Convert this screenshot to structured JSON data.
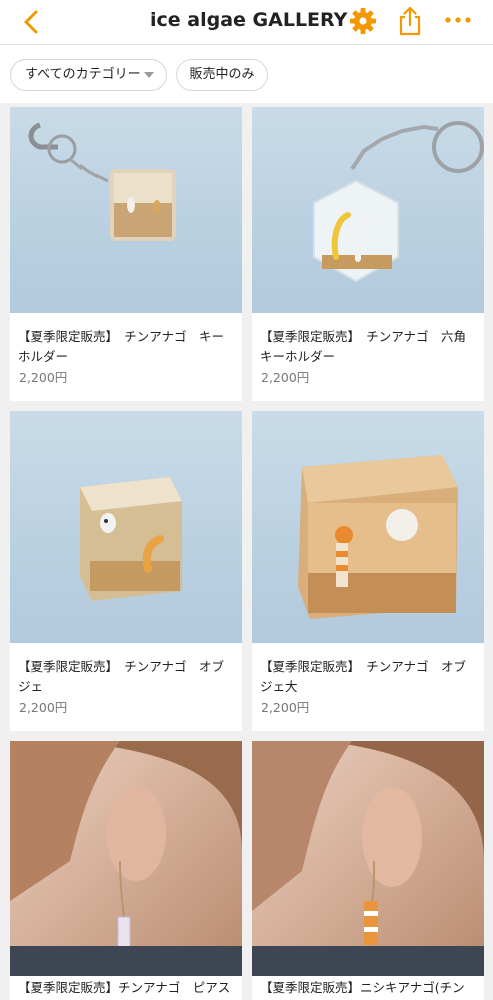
{
  "header": {
    "title": "ice algae GALLERY",
    "accent_color": "#f39800",
    "icons": [
      "chevron-left-icon",
      "gear-icon",
      "share-icon",
      "more-icon"
    ]
  },
  "filters": {
    "category_label": "すべてのカテゴリー",
    "on_sale_label": "販売中のみ"
  },
  "products": [
    {
      "name": "【夏季限定販売】　チンアナゴ　キーホルダー",
      "price": "2,200円"
    },
    {
      "name": "【夏季限定販売】　チンアナゴ　六角キーホルダー",
      "price": "2,200円"
    },
    {
      "name": "【夏季限定販売】　チンアナゴ　オブジェ",
      "price": "2,200円"
    },
    {
      "name": "【夏季限定販売】　チンアナゴ　オブジェ大",
      "price": "2,200円"
    },
    {
      "name": "【夏季限定販売】チンアナゴ　ピアス",
      "price": ""
    },
    {
      "name": "【夏季限定販売】ニシキアナゴ(チン",
      "price": ""
    }
  ]
}
